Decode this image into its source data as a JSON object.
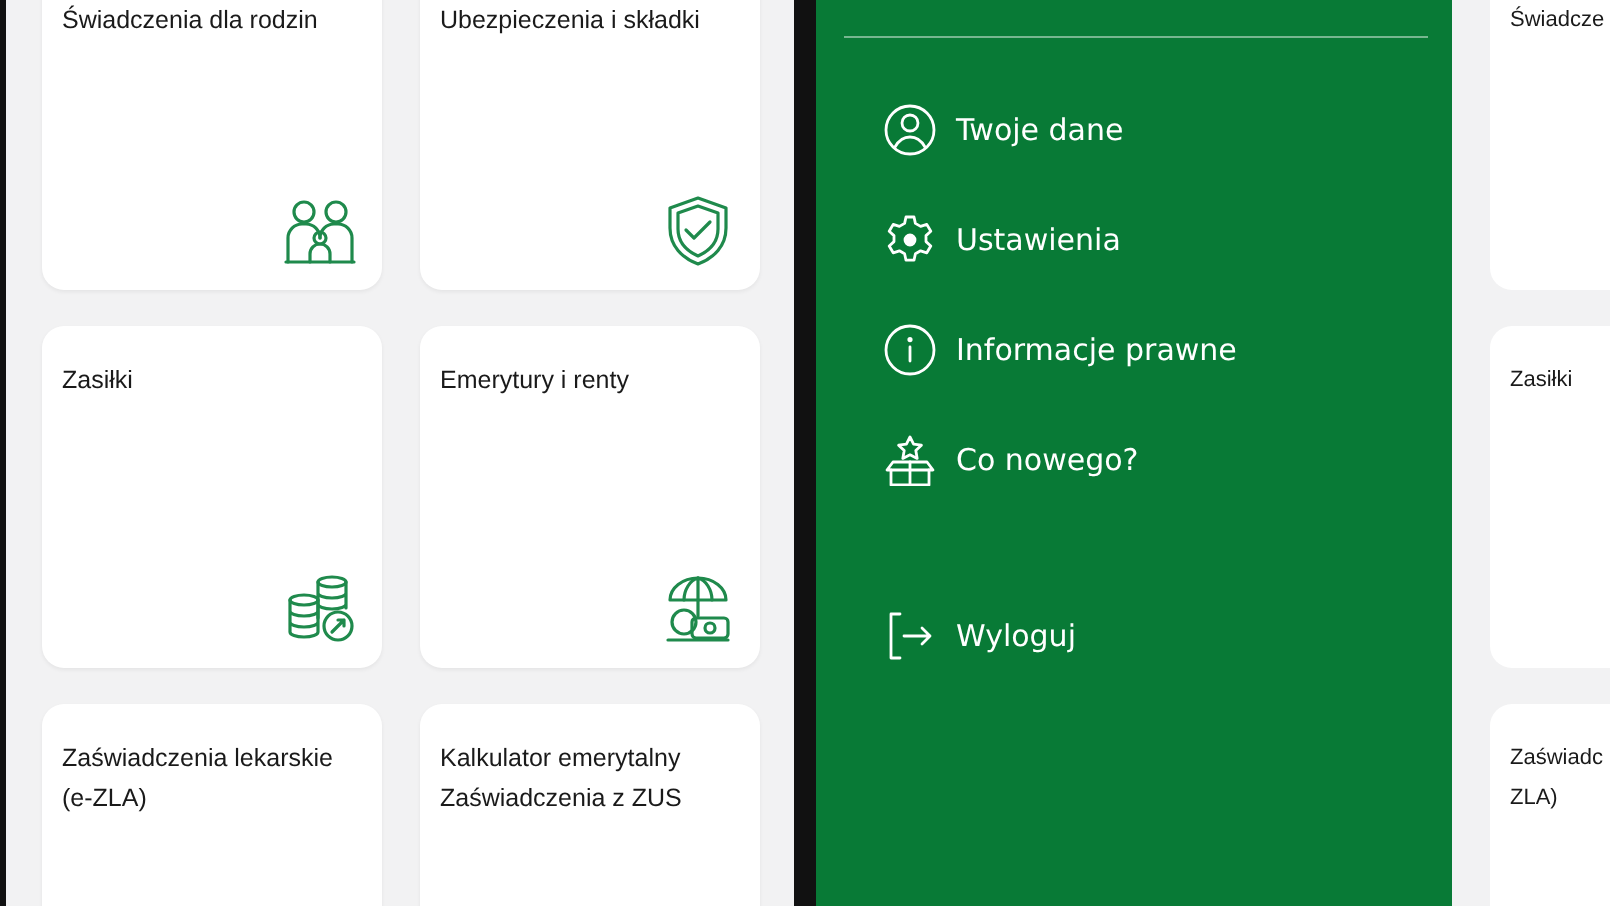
{
  "left_screen": {
    "tiles": [
      {
        "title": "Świadczenia dla rodzin",
        "kind": "family"
      },
      {
        "title": "Ubezpieczenia i składki",
        "kind": "shield"
      },
      {
        "title": "Zasiłki",
        "kind": "coins"
      },
      {
        "title": "Emerytury i renty",
        "kind": "umbrella"
      },
      {
        "title": "Zaświadczenia lekarskie (e-ZLA)",
        "kind": "plain"
      },
      {
        "title": "Kalkulator emerytalny Zaświadczenia z ZUS",
        "kind": "plain"
      }
    ]
  },
  "drawer": {
    "items": [
      {
        "label": "Twoje dane",
        "kind": "person"
      },
      {
        "label": "Ustawienia",
        "kind": "gear"
      },
      {
        "label": "Informacje prawne",
        "kind": "info"
      },
      {
        "label": "Co nowego?",
        "kind": "gift"
      },
      {
        "label": "Wyloguj",
        "kind": "logout"
      }
    ]
  },
  "right_screen": {
    "tiles": [
      {
        "lines": [
          "Świadcze"
        ]
      },
      {
        "lines": [
          "Zasiłki"
        ]
      },
      {
        "lines": [
          "Zaświadc",
          "ZLA)"
        ]
      }
    ]
  }
}
